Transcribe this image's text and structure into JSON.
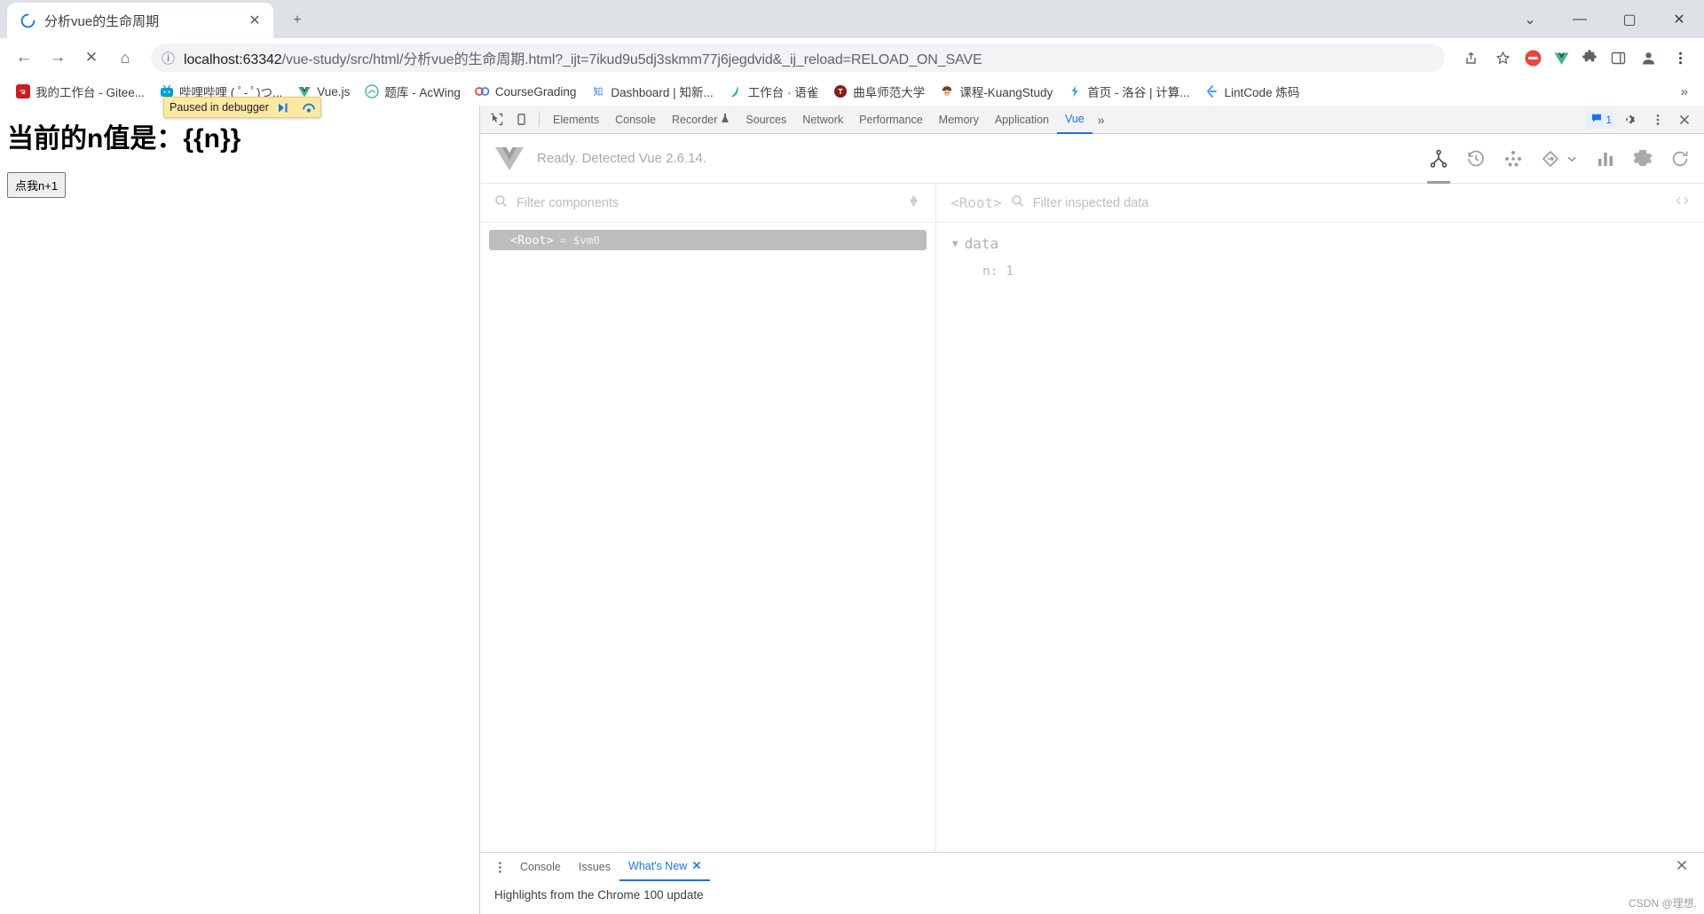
{
  "browser": {
    "tab": {
      "title": "分析vue的生命周期",
      "favicon": "chrome-loading-icon",
      "close_label": "✕"
    },
    "new_tab_label": "+",
    "window_controls": {
      "expand": "⌄",
      "minimize": "—",
      "maximize": "▢",
      "close": "✕"
    },
    "toolbar": {
      "back": "←",
      "forward": "→",
      "stop": "✕",
      "home": "⌂",
      "site_info": "ⓘ",
      "url_host": "localhost:63342",
      "url_path": "/vue-study/src/html/分析vue的生命周期.html?_ijt=7ikud9u5dj3skmm77j6jegdvid&_ij_reload=RELOAD_ON_SAVE",
      "share_icon": "share-icon",
      "bookmark_icon": "star-icon",
      "profile_icon": "profile-icon",
      "menu_icon": "kebab-menu-icon"
    },
    "bookmarks": [
      {
        "label": "我的工作台 - Gitee...",
        "icon": "gitee-icon",
        "color": "#c71d23"
      },
      {
        "label": "哔哩哔哩 ( ﾟ- ﾟ)つ...",
        "icon": "bilibili-icon",
        "color": "#00a1d6"
      },
      {
        "label": "Vue.js",
        "icon": "vue-icon",
        "color": "#41b883"
      },
      {
        "label": "题库 - AcWing",
        "icon": "acwing-icon",
        "color": "#3cb371"
      },
      {
        "label": "CourseGrading",
        "icon": "coursegrading-icon",
        "color": "#e8453c"
      },
      {
        "label": "Dashboard | 知新...",
        "icon": "zhixin-icon",
        "color": "#3e7bfa"
      },
      {
        "label": "工作台 · 语雀",
        "icon": "yuque-icon",
        "color": "#25b864"
      },
      {
        "label": "曲阜师范大学",
        "icon": "qfnu-icon",
        "color": "#8b1a1a"
      },
      {
        "label": "课程-KuangStudy",
        "icon": "kuangstudy-icon",
        "color": "#6b4226"
      },
      {
        "label": "首页 - 洛谷 | 计算...",
        "icon": "luogu-icon",
        "color": "#3498db"
      },
      {
        "label": "LintCode 炼码",
        "icon": "lintcode-icon",
        "color": "#1e90ff"
      }
    ],
    "bookmarks_overflow": "»"
  },
  "webpage": {
    "heading": "当前的n值是：{{n}}",
    "button_label": "点我n+1",
    "debugger_banner": {
      "text": "Paused in debugger",
      "resume_icon": "resume-script-icon",
      "step_icon": "step-over-icon"
    }
  },
  "devtools": {
    "inspect_icon": "inspect-element-icon",
    "device_icon": "device-toolbar-icon",
    "tabs": [
      {
        "label": "Elements",
        "active": false
      },
      {
        "label": "Console",
        "active": false
      },
      {
        "label": "Recorder",
        "active": false,
        "suffix_icon": "flask-icon"
      },
      {
        "label": "Sources",
        "active": false
      },
      {
        "label": "Network",
        "active": false
      },
      {
        "label": "Performance",
        "active": false
      },
      {
        "label": "Memory",
        "active": false
      },
      {
        "label": "Application",
        "active": false
      },
      {
        "label": "Vue",
        "active": true
      }
    ],
    "more_tabs": "»",
    "issues_badge": {
      "icon": "message-icon",
      "count": "1"
    },
    "settings_icon": "gear-icon",
    "kebab_icon": "kebab-menu-icon",
    "close_icon": "close-icon"
  },
  "vue_panel": {
    "logo": "vue-logo-icon",
    "status": "Ready. Detected Vue 2.6.14.",
    "tools": [
      {
        "name": "components-tree-icon",
        "active": true
      },
      {
        "name": "timeline-history-icon",
        "active": false
      },
      {
        "name": "vuex-icon",
        "active": false
      },
      {
        "name": "routing-icon",
        "active": false,
        "has_chevron": true
      },
      {
        "name": "performance-bars-icon",
        "active": false
      },
      {
        "name": "settings-icon",
        "active": false
      },
      {
        "name": "refresh-icon",
        "active": false
      }
    ],
    "filter_components_placeholder": "Filter components",
    "select_component_icon": "target-icon",
    "tree": [
      {
        "tag": "<Root>",
        "assign": "= $vm0",
        "selected": true
      }
    ],
    "inspected": {
      "root_label": "<Root>",
      "filter_placeholder": "Filter inspected data",
      "code_icon": "angle-brackets-icon",
      "groups": [
        {
          "name": "data",
          "expanded": true,
          "entries": [
            {
              "key": "n",
              "value": "1"
            }
          ]
        }
      ]
    }
  },
  "drawer": {
    "kebab_icon": "kebab-menu-icon",
    "tabs": [
      {
        "label": "Console",
        "active": false,
        "closable": false
      },
      {
        "label": "Issues",
        "active": false,
        "closable": false
      },
      {
        "label": "What's New",
        "active": true,
        "closable": true
      }
    ],
    "close_icon": "close-icon",
    "content": "Highlights from the Chrome 100 update"
  },
  "watermark": "CSDN @理想."
}
